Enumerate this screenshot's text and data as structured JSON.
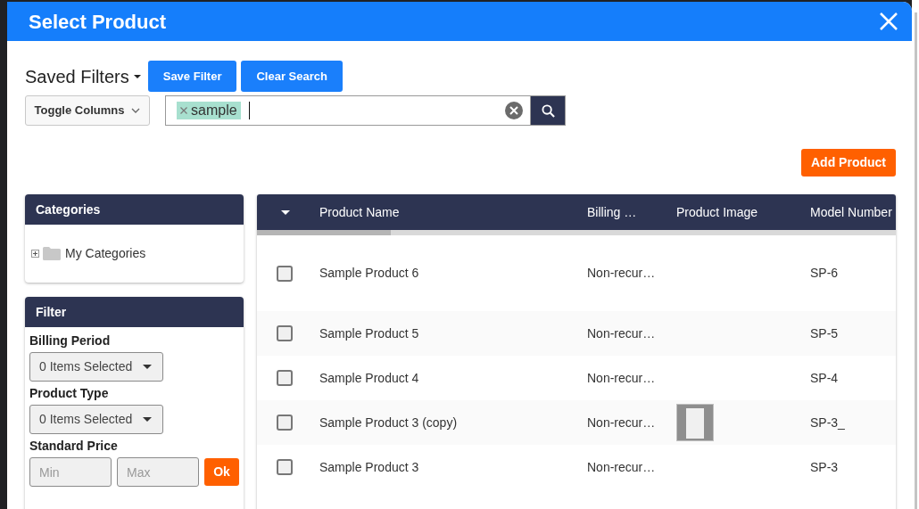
{
  "dialog": {
    "title": "Select Product"
  },
  "toolbar": {
    "saved_filters": "Saved Filters",
    "buttons": [
      {
        "label": "Save Filter"
      },
      {
        "label": "Clear Search"
      }
    ],
    "toggle_columns": "Toggle Columns",
    "search": {
      "tags": [
        "sample"
      ]
    },
    "add_button": "Add Product"
  },
  "categories": {
    "title": "Categories",
    "tree": [
      {
        "label": "My Categories",
        "expanded": false
      }
    ]
  },
  "filter": {
    "title": "Filter",
    "dropdowns": [
      {
        "label": "Billing Period",
        "value": "0 Items Selected"
      },
      {
        "label": "Product Type",
        "value": "0 Items Selected"
      }
    ],
    "price": {
      "label": "Standard Price",
      "min_placeholder": "Min",
      "max_placeholder": "Max",
      "button": "Ok"
    }
  },
  "table": {
    "columns": [
      "Product Name",
      "Billing …",
      "Product Image",
      "Model Number"
    ],
    "rows": [
      {
        "checked": false,
        "name": "Sample Product 6",
        "billing": "Non-recur…",
        "has_image": false,
        "model": "SP-6"
      },
      {
        "checked": false,
        "name": "Sample Product 5",
        "billing": "Non-recur…",
        "has_image": false,
        "model": "SP-5"
      },
      {
        "checked": false,
        "name": "Sample Product 4",
        "billing": "Non-recur…",
        "has_image": false,
        "model": "SP-4"
      },
      {
        "checked": false,
        "name": "Sample Product 3 (copy)",
        "billing": "Non-recur…",
        "has_image": true,
        "model": "SP-3_"
      },
      {
        "checked": false,
        "name": "Sample Product 3",
        "billing": "Non-recur…",
        "has_image": false,
        "model": "SP-3"
      }
    ]
  }
}
